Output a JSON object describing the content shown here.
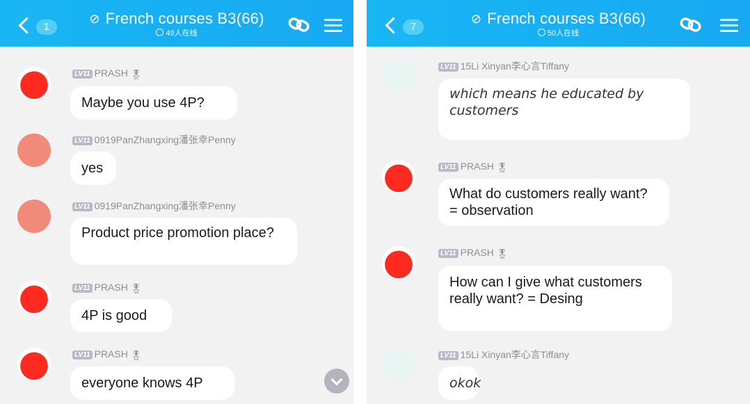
{
  "left": {
    "header": {
      "badge": "1",
      "title": "French courses B3(66)",
      "subtitle": "49人在线"
    },
    "messages": [
      {
        "sender": "PRASH",
        "level": "LV11",
        "text": "Maybe you use 4P?"
      },
      {
        "sender": "0919PanZhangxing潘张幸Penny",
        "level": "LV11",
        "text": "yes"
      },
      {
        "sender": "0919PanZhangxing潘张幸Penny",
        "level": "LV11",
        "text": "Product price promotion place?"
      },
      {
        "sender": "PRASH",
        "level": "LV11",
        "text": "4P is good"
      },
      {
        "sender": "PRASH",
        "level": "LV11",
        "text": "everyone knows 4P"
      }
    ]
  },
  "right": {
    "header": {
      "badge": "7",
      "title": "French courses B3(66)",
      "subtitle": "50人在线"
    },
    "messages": [
      {
        "sender": "15Li Xinyan李心言Tiffany",
        "level": "LV11",
        "text": "which means he educated by customers"
      },
      {
        "sender": "PRASH",
        "level": "LV11",
        "text": "What do customers really want? = observation"
      },
      {
        "sender": "PRASH",
        "level": "LV11",
        "text": "How can I give what customers really want? = Desing"
      },
      {
        "sender": "15Li Xinyan李心言Tiffany",
        "level": "LV11",
        "text": "okok"
      }
    ]
  },
  "colors": {
    "header": "#17adf3",
    "background": "#f2f2f2",
    "bubble": "#ffffff",
    "meta": "#8e8e8e"
  },
  "icons": [
    "back-chevron-icon",
    "link-icon",
    "menu-icon",
    "online-icon",
    "scroll-down-icon"
  ]
}
